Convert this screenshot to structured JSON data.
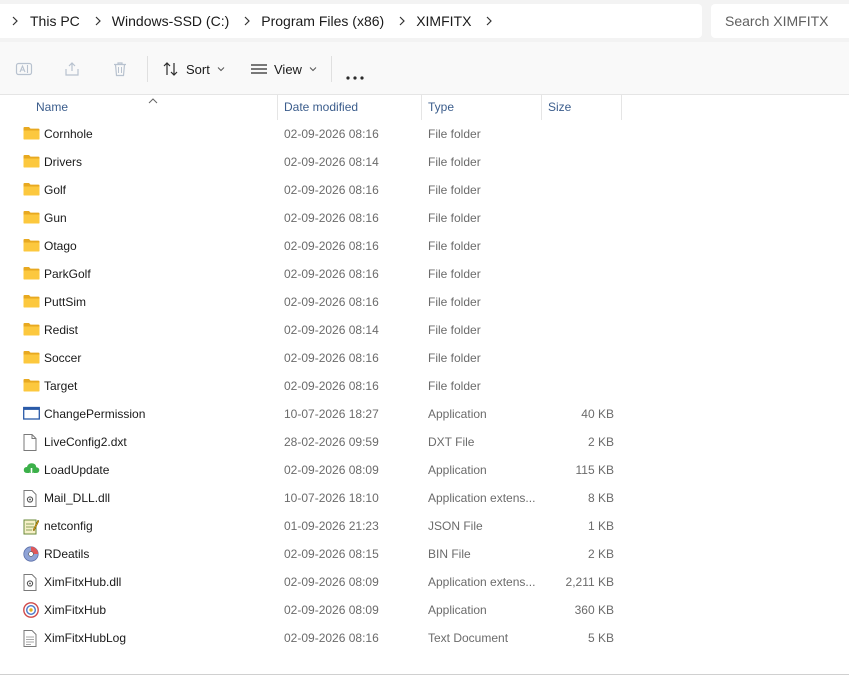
{
  "breadcrumbs": [
    "This PC",
    "Windows-SSD (C:)",
    "Program Files (x86)",
    "XIMFITX"
  ],
  "search": {
    "placeholder": "Search XIMFITX"
  },
  "toolbar": {
    "sort_label": "Sort",
    "view_label": "View"
  },
  "columns": {
    "name": "Name",
    "date": "Date modified",
    "type": "Type",
    "size": "Size"
  },
  "files": [
    {
      "name": "Cornhole",
      "date": "02-09-2026 08:16",
      "type": "File folder",
      "size": "",
      "icon": "folder-icon"
    },
    {
      "name": "Drivers",
      "date": "02-09-2026 08:14",
      "type": "File folder",
      "size": "",
      "icon": "folder-icon"
    },
    {
      "name": "Golf",
      "date": "02-09-2026 08:16",
      "type": "File folder",
      "size": "",
      "icon": "folder-icon"
    },
    {
      "name": "Gun",
      "date": "02-09-2026 08:16",
      "type": "File folder",
      "size": "",
      "icon": "folder-icon"
    },
    {
      "name": "Otago",
      "date": "02-09-2026 08:16",
      "type": "File folder",
      "size": "",
      "icon": "folder-icon"
    },
    {
      "name": "ParkGolf",
      "date": "02-09-2026 08:16",
      "type": "File folder",
      "size": "",
      "icon": "folder-icon"
    },
    {
      "name": "PuttSim",
      "date": "02-09-2026 08:16",
      "type": "File folder",
      "size": "",
      "icon": "folder-icon"
    },
    {
      "name": "Redist",
      "date": "02-09-2026 08:14",
      "type": "File folder",
      "size": "",
      "icon": "folder-icon"
    },
    {
      "name": "Soccer",
      "date": "02-09-2026 08:16",
      "type": "File folder",
      "size": "",
      "icon": "folder-icon"
    },
    {
      "name": "Target",
      "date": "02-09-2026 08:16",
      "type": "File folder",
      "size": "",
      "icon": "folder-icon"
    },
    {
      "name": "ChangePermission",
      "date": "10-07-2026 18:27",
      "type": "Application",
      "size": "40 KB",
      "icon": "app-window-icon"
    },
    {
      "name": "LiveConfig2.dxt",
      "date": "28-02-2026 09:59",
      "type": "DXT File",
      "size": "2 KB",
      "icon": "blank-file-icon"
    },
    {
      "name": "LoadUpdate",
      "date": "02-09-2026 08:09",
      "type": "Application",
      "size": "115 KB",
      "icon": "cloud-download-icon"
    },
    {
      "name": "Mail_DLL.dll",
      "date": "10-07-2026 18:10",
      "type": "Application extens...",
      "size": "8 KB",
      "icon": "dll-file-icon"
    },
    {
      "name": "netconfig",
      "date": "01-09-2026 21:23",
      "type": "JSON File",
      "size": "1 KB",
      "icon": "notepad-icon"
    },
    {
      "name": "RDeatils",
      "date": "02-09-2026 08:15",
      "type": "BIN File",
      "size": "2 KB",
      "icon": "disc-icon"
    },
    {
      "name": "XimFitxHub.dll",
      "date": "02-09-2026 08:09",
      "type": "Application extens...",
      "size": "2,211 KB",
      "icon": "dll-file-icon"
    },
    {
      "name": "XimFitxHub",
      "date": "02-09-2026 08:09",
      "type": "Application",
      "size": "360 KB",
      "icon": "ximfitx-app-icon"
    },
    {
      "name": "XimFitxHubLog",
      "date": "02-09-2026 08:16",
      "type": "Text Document",
      "size": "5 KB",
      "icon": "text-document-icon"
    }
  ]
}
